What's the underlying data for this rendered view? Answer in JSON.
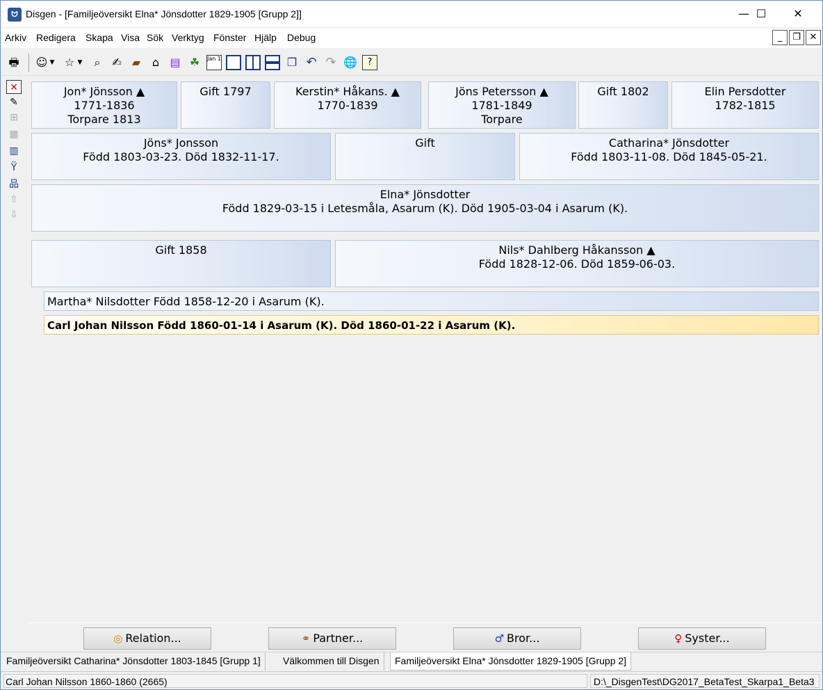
{
  "window": {
    "title": "Disgen - [Familjeöversikt Elna* Jönsdotter 1829-1905 [Grupp 2]]",
    "app_icon_glyph": "ᗢ",
    "minimize": "—",
    "maximize": "☐",
    "close": "✕"
  },
  "menu": {
    "items": [
      "Arkiv",
      "Redigera",
      "Skapa",
      "Visa",
      "Sök",
      "Verktyg",
      "Fönster",
      "Hjälp",
      "Debug"
    ],
    "mdi_minimize": "_",
    "mdi_restore": "❐",
    "mdi_close": "✕"
  },
  "toolbar": {
    "icons": [
      "printer-icon",
      "person-icon",
      "person-star-icon",
      "binoculars-icon",
      "hand-document-icon",
      "book-icon",
      "house-icon",
      "books-icon",
      "green-shape-icon",
      "calendar-icon",
      "window-icon",
      "split-window-icon",
      "horizontal-split-icon",
      "cascade-icon",
      "undo-icon",
      "redo-icon",
      "globe-icon",
      "help-icon"
    ],
    "calendar_text": "Jan 1",
    "help_text": "?"
  },
  "sidebar": {
    "icons": [
      "delete-icon",
      "edit-note-icon",
      "tree-icon",
      "portrait-icon",
      "columns-icon",
      "descendants-icon",
      "hierarchy-icon",
      "move-up-icon",
      "move-down-icon"
    ]
  },
  "family": {
    "grandparents": [
      {
        "name": "Jon* Jönsson ▲",
        "years": "1771-1836",
        "note": "Torpare  1813"
      },
      {
        "name": "Gift 1797",
        "years": "",
        "note": ""
      },
      {
        "name": "Kerstin* Håkans. ▲",
        "years": "1770-1839",
        "note": ""
      },
      {
        "name": "Jöns Petersson ▲",
        "years": "1781-1849",
        "note": "Torpare"
      },
      {
        "name": "Gift 1802",
        "years": "",
        "note": ""
      },
      {
        "name": "Elin Persdotter",
        "years": "1782-1815",
        "note": ""
      }
    ],
    "parents": [
      {
        "name": "Jöns* Jonsson",
        "info": "Född 1803-03-23. Död 1832-11-17."
      },
      {
        "name": "Gift",
        "info": ""
      },
      {
        "name": "Catharina* Jönsdotter",
        "info": "Född 1803-11-08. Död 1845-05-21."
      }
    ],
    "main": {
      "name": "Elna* Jönsdotter",
      "info": "Född 1829-03-15 i Letesmåla, Asarum (K). Död 1905-03-04 i Asarum (K)."
    },
    "marriage": {
      "label": "Gift 1858"
    },
    "spouse": {
      "name": "Nils* Dahlberg Håkansson ▲",
      "info": "Född 1828-12-06. Död 1859-06-03."
    },
    "children": [
      {
        "text": "Martha* Nilsdotter Född 1858-12-20 i Asarum (K).",
        "selected": false
      },
      {
        "text": "Carl Johan Nilsson Född 1860-01-14 i Asarum (K). Död 1860-01-22 i Asarum (K).",
        "selected": true
      }
    ]
  },
  "buttons": {
    "relation": "Relation...",
    "partner": "Partner...",
    "bror": "Bror...",
    "syster": "Syster..."
  },
  "tabs": [
    {
      "label": "Familjeöversikt Catharina* Jönsdotter 1803-1845 [Grupp 1]",
      "active": false
    },
    {
      "label": "Välkommen till Disgen",
      "active": false
    },
    {
      "label": "Familjeöversikt Elna* Jönsdotter 1829-1905 [Grupp 2]",
      "active": true
    }
  ],
  "status": {
    "left": "Carl Johan Nilsson 1860-1860 (2665)",
    "right": "D:\\_DisgenTest\\DG2017_BetaTest_Skarpa1_Beta3"
  }
}
